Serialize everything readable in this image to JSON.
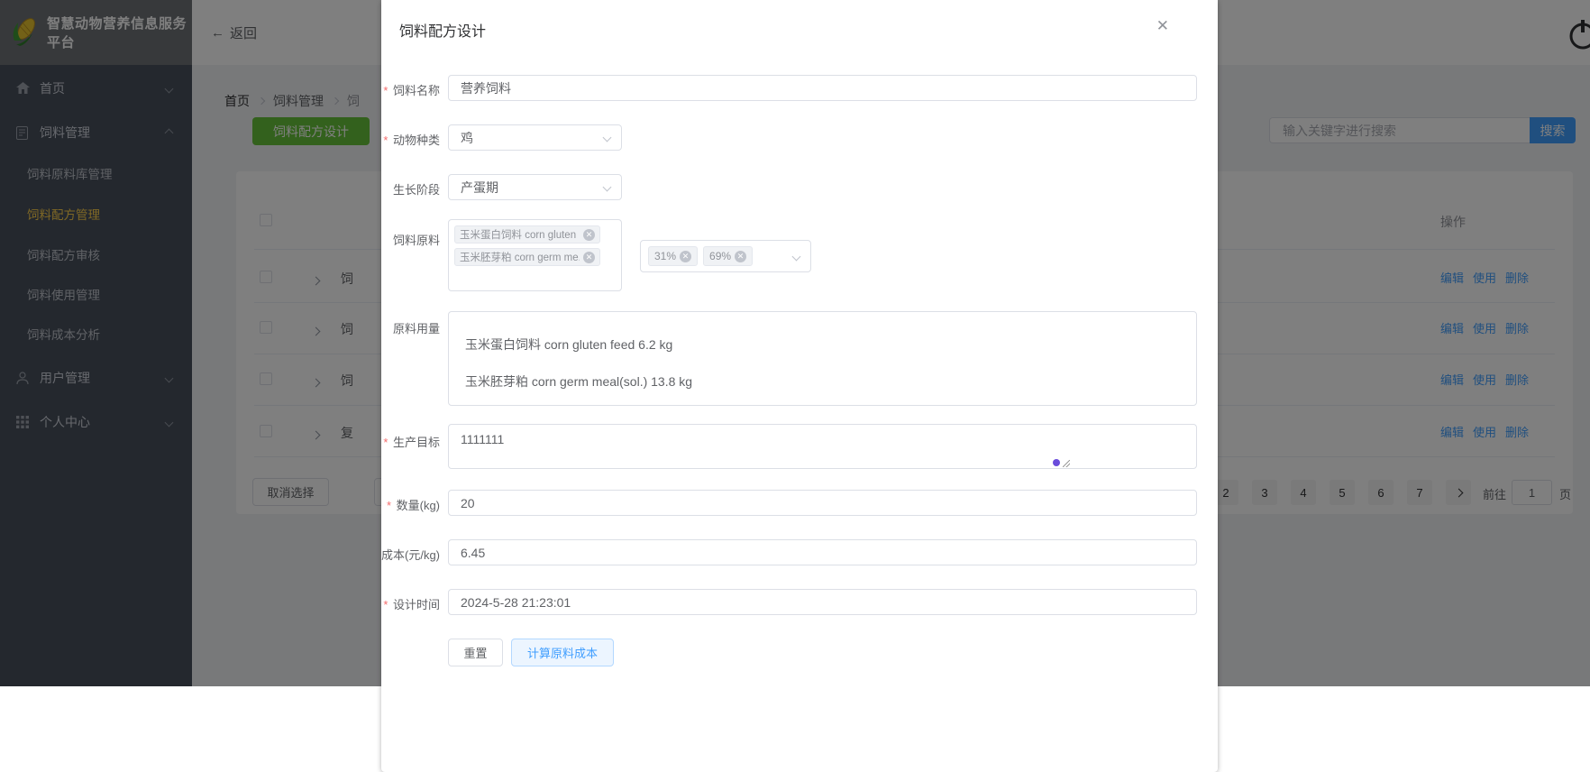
{
  "app": {
    "title": "智慧动物营养信息服务平台",
    "back": "返回"
  },
  "sidebar": {
    "items": [
      {
        "label": "首页"
      },
      {
        "label": "饲料管理",
        "children": [
          "饲料原料库管理",
          "饲料配方管理",
          "饲料配方审核",
          "饲料使用管理",
          "饲料成本分析"
        ],
        "active_child": "饲料配方管理"
      },
      {
        "label": "用户管理"
      },
      {
        "label": "个人中心"
      }
    ]
  },
  "breadcrumb": [
    "首页",
    "饲料管理",
    "饲"
  ],
  "toolbar": {
    "design_button": "饲料配方设计",
    "search_placeholder": "输入关键字进行搜索",
    "search_button": "搜索"
  },
  "table": {
    "action_header": "操作",
    "action_labels": [
      "编辑",
      "使用",
      "删除"
    ],
    "rows": [
      {
        "first_cell": "饲"
      },
      {
        "first_cell": "饲"
      },
      {
        "first_cell": "饲"
      },
      {
        "first_cell": "复"
      }
    ],
    "cancel_selection": "取消选择"
  },
  "pagination": {
    "pages": [
      "2",
      "3",
      "4",
      "5",
      "6",
      "7"
    ],
    "goto_label": "前往",
    "goto_value": "1",
    "goto_suffix": "页"
  },
  "modal": {
    "title": "饲料配方设计",
    "fields": {
      "name": {
        "label": "饲料名称",
        "value": "营养饲料"
      },
      "species": {
        "label": "动物种类",
        "value": "鸡"
      },
      "stage": {
        "label": "生长阶段",
        "value": "产蛋期"
      },
      "ingredients": {
        "label": "饲料原料",
        "tags": [
          "玉米蛋白饲料 corn gluten ...",
          "玉米胚芽粕 corn germ me..."
        ],
        "ratio_tags": [
          "31%",
          "69%"
        ]
      },
      "usage": {
        "label": "原料用量",
        "lines": [
          "玉米蛋白饲料 corn gluten feed 6.2 kg",
          "玉米胚芽粕 corn germ meal(sol.) 13.8 kg"
        ]
      },
      "target": {
        "label": "生产目标",
        "value": "1111111"
      },
      "quantity": {
        "label": "数量(kg)",
        "value": "20"
      },
      "cost": {
        "label": "成本(元/kg)",
        "value": "6.45"
      },
      "time": {
        "label": "设计时间",
        "value": "2024-5-28 21:23:01"
      }
    },
    "buttons": {
      "reset": "重置",
      "calc": "计算原料成本"
    }
  },
  "colors": {
    "primary": "#409eff",
    "success": "#67c23a",
    "sidebar_active": "#ffd04b",
    "required_star": "#f56c6c"
  },
  "icons": {
    "close": "✕",
    "back_arrow": "←"
  }
}
